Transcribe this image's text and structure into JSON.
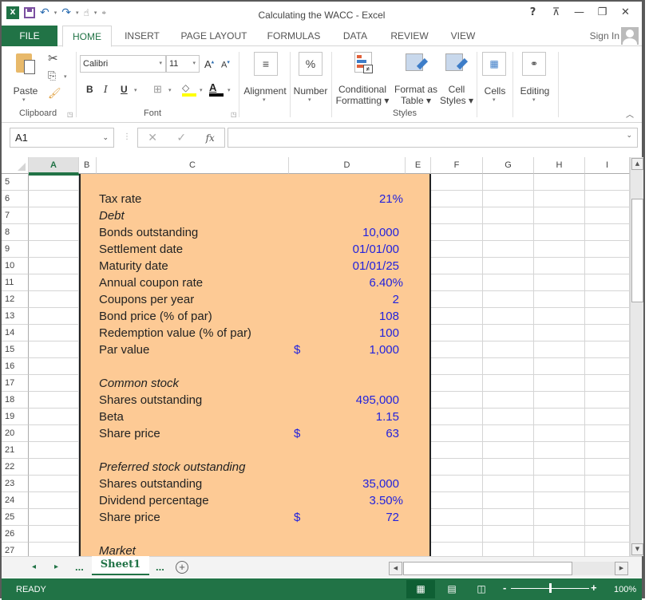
{
  "app": {
    "title": "Calculating the WACC - Excel",
    "logo_text": "X",
    "window_controls": {
      "help": "?",
      "ribbon_display": "⊼",
      "minimize": "—",
      "restore": "❐",
      "close": "✕"
    }
  },
  "quick_access": {
    "icons": [
      "excel-logo",
      "save-icon",
      "undo-icon",
      "redo-icon",
      "touch-mode-icon",
      "customize-icon"
    ]
  },
  "tabs": [
    {
      "label": "FILE"
    },
    {
      "label": "HOME",
      "active": true
    },
    {
      "label": "INSERT"
    },
    {
      "label": "PAGE LAYOUT"
    },
    {
      "label": "FORMULAS"
    },
    {
      "label": "DATA"
    },
    {
      "label": "REVIEW"
    },
    {
      "label": "VIEW"
    }
  ],
  "account": {
    "sign_in": "Sign In"
  },
  "ribbon": {
    "clipboard": {
      "label": "Clipboard",
      "paste": "Paste"
    },
    "font": {
      "label": "Font",
      "font_name": "Calibri",
      "font_size": "11",
      "bold": "B",
      "italic": "I",
      "underline": "U",
      "grow": "A",
      "shrink": "A",
      "font_color": "A",
      "fill_color": "#ffff00",
      "text_color": "#000000"
    },
    "alignment": {
      "label": "Alignment"
    },
    "number": {
      "label": "Number",
      "glyph": "%"
    },
    "styles": {
      "label": "Styles",
      "conditional_formatting_1": "Conditional",
      "conditional_formatting_2": "Formatting ▾",
      "format_as_table_1": "Format as",
      "format_as_table_2": "Table ▾",
      "cell_styles_1": "Cell",
      "cell_styles_2": "Styles ▾"
    },
    "cells": {
      "label": "Cells"
    },
    "editing": {
      "label": "Editing"
    }
  },
  "formula_bar": {
    "name_box": "A1",
    "cancel": "✕",
    "enter": "✓",
    "fx": "fx",
    "value": ""
  },
  "grid": {
    "columns": [
      "A",
      "B",
      "C",
      "D",
      "E",
      "F",
      "G",
      "H",
      "I"
    ],
    "selected_column": "A",
    "rows": [
      "5",
      "6",
      "7",
      "8",
      "9",
      "10",
      "11",
      "12",
      "13",
      "14",
      "15",
      "16",
      "17",
      "18",
      "19",
      "20",
      "21",
      "22",
      "23",
      "24",
      "25",
      "26",
      "27"
    ],
    "block_fill": "#fdca95",
    "value_color": "#2222dd",
    "entries": [
      {
        "row": "6",
        "label": "Tax rate",
        "value": "21%"
      },
      {
        "row": "7",
        "label": "Debt",
        "italic": true
      },
      {
        "row": "8",
        "label": "Bonds outstanding",
        "value": "10,000"
      },
      {
        "row": "9",
        "label": "Settlement date",
        "value": "01/01/00"
      },
      {
        "row": "10",
        "label": "Maturity date",
        "value": "01/01/25"
      },
      {
        "row": "11",
        "label": "Annual coupon rate",
        "value": "6.40%"
      },
      {
        "row": "12",
        "label": "Coupons per year",
        "value": "2"
      },
      {
        "row": "13",
        "label": "Bond price (% of par)",
        "value": "108"
      },
      {
        "row": "14",
        "label": "Redemption value (% of par)",
        "value": "100"
      },
      {
        "row": "15",
        "label": "Par value",
        "currency": "$",
        "value": "1,000"
      },
      {
        "row": "17",
        "label": "Common stock",
        "italic": true
      },
      {
        "row": "18",
        "label": "Shares outstanding",
        "value": "495,000"
      },
      {
        "row": "19",
        "label": "Beta",
        "value": "1.15"
      },
      {
        "row": "20",
        "label": "Share price",
        "currency": "$",
        "value": "63"
      },
      {
        "row": "22",
        "label": "Preferred stock outstanding",
        "italic": true
      },
      {
        "row": "23",
        "label": "Shares outstanding",
        "value": "35,000"
      },
      {
        "row": "24",
        "label": "Dividend percentage",
        "value": "3.50%"
      },
      {
        "row": "25",
        "label": "Share price",
        "currency": "$",
        "value": "72"
      },
      {
        "row": "27",
        "label": "Market",
        "italic": true
      }
    ]
  },
  "sheets": {
    "prev": "◂",
    "next": "▸",
    "more_left": "...",
    "active": "Sheet1",
    "more_right": "...",
    "add": "+"
  },
  "status": {
    "mode": "READY",
    "zoom": "100%",
    "zoom_percent": 100
  }
}
